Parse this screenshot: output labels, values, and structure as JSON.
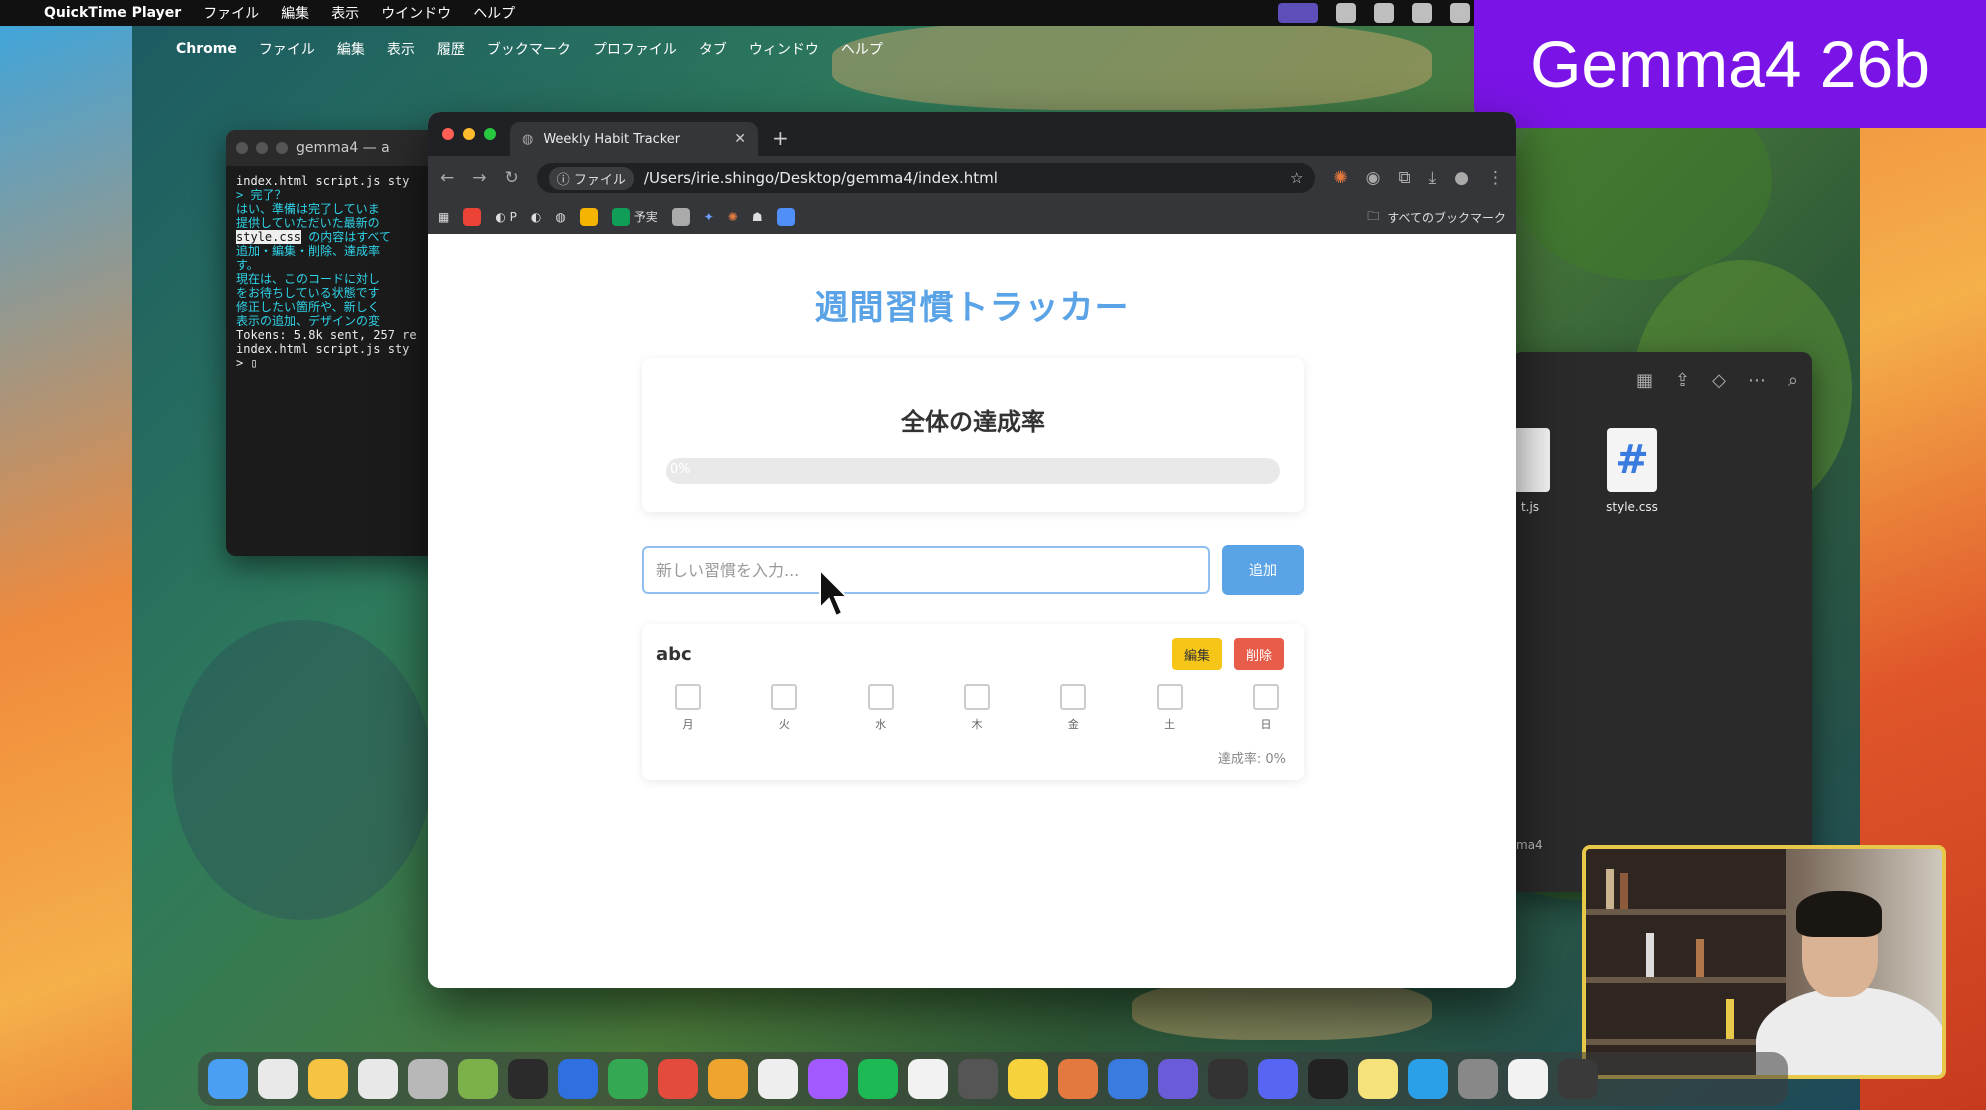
{
  "qt_menubar": {
    "apple": "",
    "app_name": "QuickTime Player",
    "items": [
      "ファイル",
      "編集",
      "表示",
      "ウインドウ",
      "ヘルプ"
    ]
  },
  "chrome_menubar": {
    "apple": "",
    "app_name": "Chrome",
    "items": [
      "ファイル",
      "編集",
      "表示",
      "履歴",
      "ブックマーク",
      "プロファイル",
      "タブ",
      "ウィンドウ",
      "ヘルプ"
    ]
  },
  "badge": {
    "label": "Gemma4 26b"
  },
  "terminal": {
    "title": "gemma4 — a",
    "lines": [
      {
        "text": "index.html script.js sty",
        "kind": "w"
      },
      {
        "text": "> 完了？",
        "kind": "n"
      },
      {
        "text": "",
        "kind": "n"
      },
      {
        "text": "はい、準備は完了していま",
        "kind": "n"
      },
      {
        "text": "",
        "kind": "n"
      },
      {
        "text": "提供していただいた最新の",
        "kind": "n"
      },
      {
        "text": "style.css の内容はすべて",
        "kind": "hl"
      },
      {
        "text": "追加・編集・削除、達成率",
        "kind": "n"
      },
      {
        "text": "す。",
        "kind": "n"
      },
      {
        "text": "",
        "kind": "n"
      },
      {
        "text": "現在は、このコードに対し",
        "kind": "n"
      },
      {
        "text": "をお待ちしている状態です",
        "kind": "n"
      },
      {
        "text": "",
        "kind": "n"
      },
      {
        "text": "修正したい箇所や、新しく",
        "kind": "n"
      },
      {
        "text": "表示の追加、デザインの変",
        "kind": "n"
      },
      {
        "text": "",
        "kind": "n"
      },
      {
        "text": "",
        "kind": "n"
      },
      {
        "text": "Tokens: 5.8k sent, 257 re",
        "kind": "w"
      },
      {
        "text": "",
        "kind": "n"
      },
      {
        "text": "index.html script.js sty",
        "kind": "w"
      },
      {
        "text": "> ▯",
        "kind": "w"
      }
    ]
  },
  "finder": {
    "files": [
      {
        "name": "t.js"
      },
      {
        "name": "style.css",
        "glyph": "#"
      }
    ],
    "footer": "ma4"
  },
  "browser": {
    "tab_title": "Weekly Habit Tracker",
    "tab_close": "✕",
    "new_tab": "+",
    "address": {
      "chip": "ファイル",
      "url": "/Users/irie.shingo/Desktop/gemma4/index.html"
    },
    "bookmarks": {
      "items": [
        "P",
        "予実"
      ],
      "all_label": "すべてのブックマーク"
    }
  },
  "page": {
    "title": "週間習慣トラッカー",
    "summary_title": "全体の達成率",
    "progress": {
      "percent": 0,
      "label": "0%"
    },
    "input_placeholder": "新しい習慣を入力...",
    "add_label": "追加",
    "habit": {
      "name": "abc",
      "edit_label": "編集",
      "delete_label": "削除",
      "days": [
        "月",
        "火",
        "水",
        "木",
        "金",
        "土",
        "日"
      ],
      "checked": [
        false,
        false,
        false,
        false,
        false,
        false,
        false
      ],
      "rate_label": "達成率: 0%"
    }
  },
  "colors": {
    "accent": "#5aa3e6",
    "edit": "#f5c518",
    "delete": "#e85c4a",
    "badge": "#7a14e6"
  }
}
